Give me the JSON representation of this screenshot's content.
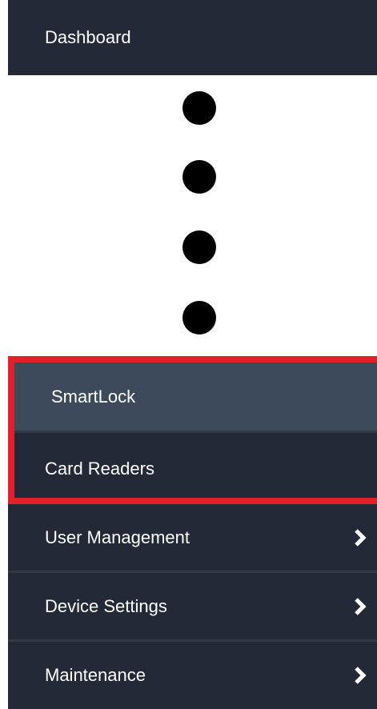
{
  "sidebar": {
    "dashboard": {
      "label": "Dashboard"
    },
    "items": [
      {
        "label": "SmartLock",
        "selected": true
      },
      {
        "label": "Card Readers"
      },
      {
        "label": "User Management",
        "icon": "chevron-right-icon"
      },
      {
        "label": "Device Settings",
        "icon": "chevron-right-icon"
      },
      {
        "label": "Maintenance",
        "icon": "chevron-right-icon"
      }
    ]
  },
  "colors": {
    "background": "#232937",
    "selected_background": "#3c4a5c",
    "text": "#ffffff",
    "highlight_border": "#e0202a",
    "ellipsis_dot": "#000000"
  }
}
